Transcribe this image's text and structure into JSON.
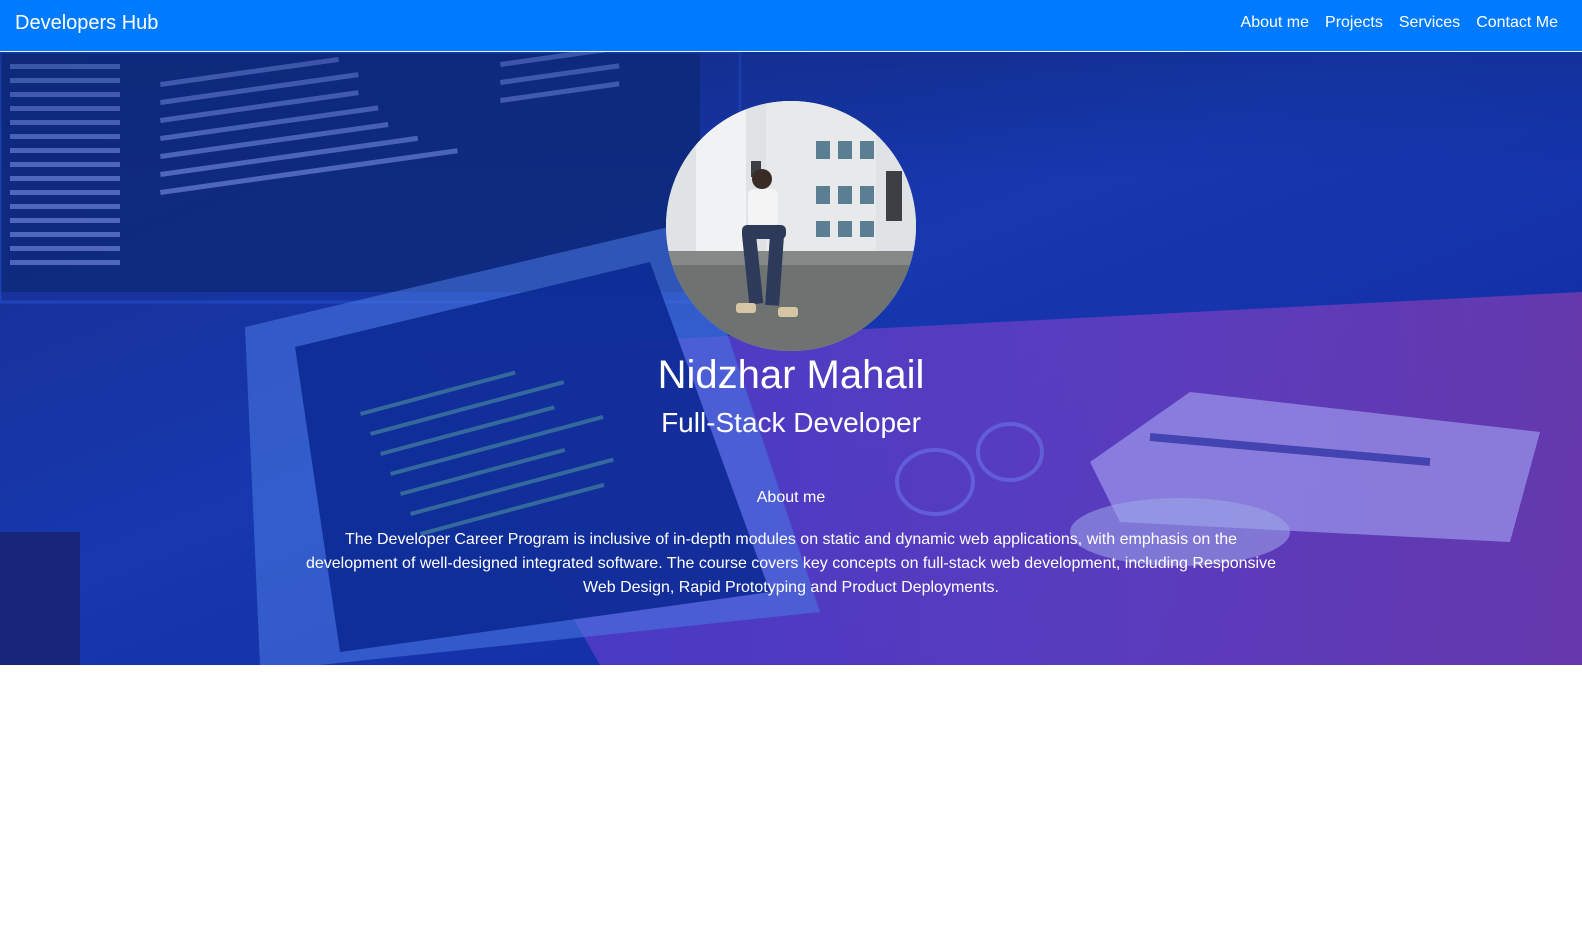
{
  "navbar": {
    "brand": "Developers Hub",
    "links": [
      "About me",
      "Projects",
      "Services",
      "Contact Me"
    ]
  },
  "hero": {
    "name": "Nidzhar Mahail",
    "role": "Full-Stack Developer",
    "about_heading": "About me",
    "about_text": "The Developer Career Program is inclusive of in-depth modules on static and dynamic web applications, with emphasis on the development of well-designed integrated software. The course covers key concepts on full-stack web development, including Responsive Web Design, Rapid Prototyping and Product Deployments."
  },
  "colors": {
    "navbar": "#007bff",
    "hero_overlay": "#1e3cc8",
    "text": "#ffffff"
  }
}
